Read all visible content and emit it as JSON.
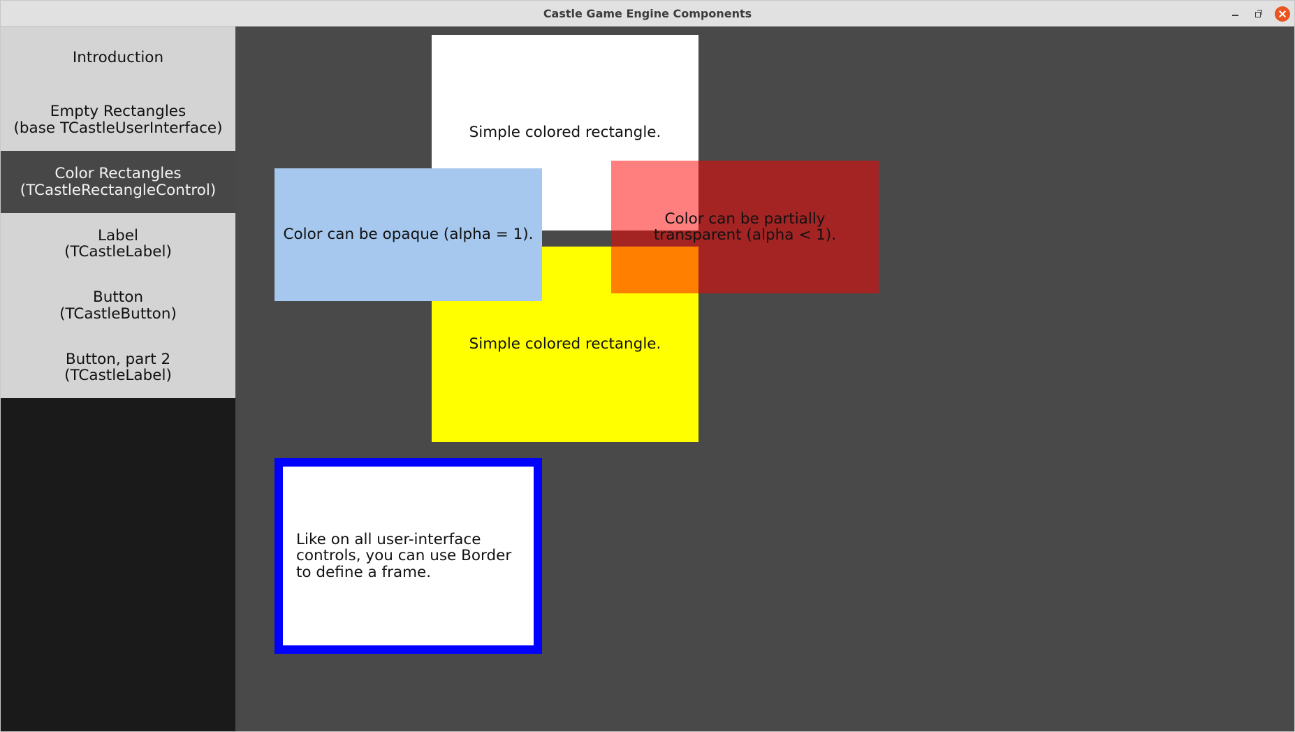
{
  "window": {
    "title": "Castle Game Engine Components",
    "controls": {
      "minimize": "minimize-icon",
      "restore": "restore-icon",
      "close": "close-icon"
    },
    "close_color": "#e95420"
  },
  "sidebar": {
    "items": [
      {
        "label": "Introduction",
        "selected": false
      },
      {
        "label": "Empty Rectangles\n(base TCastleUserInterface)",
        "selected": false
      },
      {
        "label": "Color Rectangles\n(TCastleRectangleControl)",
        "selected": true
      },
      {
        "label": "Label\n(TCastleLabel)",
        "selected": false
      },
      {
        "label": "Button\n(TCastleButton)",
        "selected": false
      },
      {
        "label": "Button, part 2\n(TCastleLabel)",
        "selected": false
      }
    ]
  },
  "content": {
    "white_rect": {
      "text": "Simple colored rectangle.",
      "color": "#ffffff"
    },
    "yellow_rect": {
      "text": "Simple colored rectangle.",
      "color": "#ffff00"
    },
    "blue_rect": {
      "text": "Color can be opaque (alpha = 1).",
      "color": "#a6c8ee",
      "alpha": 1
    },
    "red_rect": {
      "text": "Color can be partially\ntransparent (alpha < 1).",
      "color": "#ff0000",
      "alpha": 0.5
    },
    "bordered_rect": {
      "text": "Like on all user-interface\ncontrols, you can use Border\nto define a frame.",
      "color": "#ffffff",
      "border_color": "#0000ff"
    }
  }
}
